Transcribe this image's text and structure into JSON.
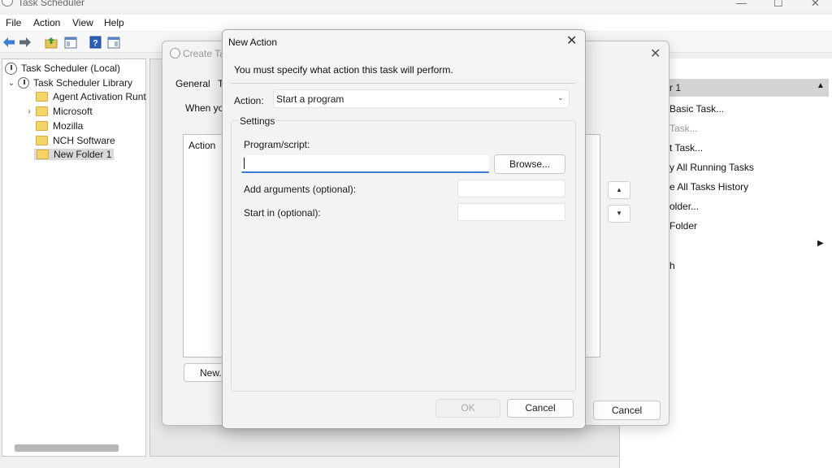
{
  "window": {
    "title": "Task Scheduler",
    "controls": {
      "minimize": "—",
      "maximize": "☐",
      "close": "✕"
    }
  },
  "menu": [
    "File",
    "Action",
    "View",
    "Help"
  ],
  "toolbar": {
    "icons": [
      "back-arrow-icon",
      "forward-arrow-icon",
      "folder-up-icon",
      "show-hide-console-icon",
      "help-icon",
      "action-pane-icon"
    ],
    "colors": {
      "arrow": "#3b7dd8",
      "help": "#2b5fb8"
    }
  },
  "tree": {
    "root": "Task Scheduler (Local)",
    "library": "Task Scheduler Library",
    "folders": [
      "Agent Activation Runt",
      "Microsoft",
      "Mozilla",
      "NCH Software",
      "New Folder 1"
    ],
    "selected": "New Folder 1"
  },
  "actions_pane": {
    "header": "r 1",
    "items": [
      {
        "label": "Basic Task...",
        "enabled": true
      },
      {
        "label": "Task...",
        "enabled": false
      },
      {
        "label": "t Task...",
        "enabled": true
      },
      {
        "label": "y All Running Tasks",
        "enabled": true
      },
      {
        "label": "e All Tasks History",
        "enabled": true
      },
      {
        "label": "older...",
        "enabled": true
      },
      {
        "label": "Folder",
        "enabled": true
      },
      {
        "label": "",
        "enabled": true
      },
      {
        "label": "h",
        "enabled": true
      }
    ]
  },
  "create_task": {
    "title": "Create Ta",
    "tabs": [
      "General",
      "T"
    ],
    "when_text": "When yo",
    "list_header": "Action",
    "new_button": "New...",
    "cancel_button": "Cancel",
    "close": "✕",
    "up": "▲",
    "down": "▼"
  },
  "new_action": {
    "title": "New Action",
    "close": "✕",
    "message": "You must specify what action this task will perform.",
    "action_label": "Action:",
    "action_value": "Start a program",
    "settings_label": "Settings",
    "program_label": "Program/script:",
    "program_value": "",
    "browse_button": "Browse...",
    "args_label": "Add arguments (optional):",
    "args_value": "",
    "start_label": "Start in (optional):",
    "start_value": "",
    "ok_button": "OK",
    "ok_enabled": false,
    "cancel_button": "Cancel",
    "focus_color": "#3a7bd5"
  }
}
